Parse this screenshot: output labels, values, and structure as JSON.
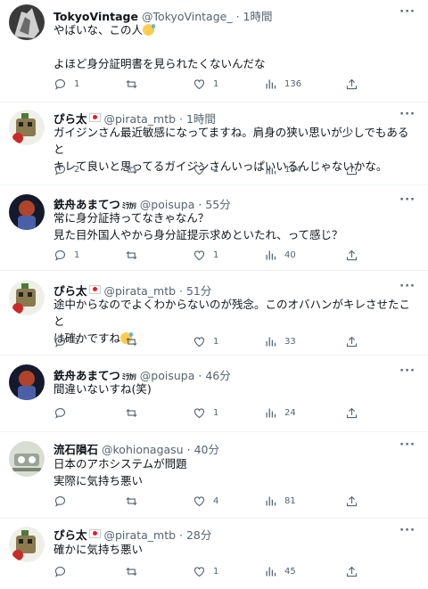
{
  "tweets": [
    {
      "name": "TokyoVintage",
      "handle": "@TokyoVintage_",
      "time": "1時間",
      "lines": [
        "やばいな、この人",
        "",
        "よほど身分証明書を見られたくないんだな"
      ],
      "emoji_after_line_1": "grinning-sweat",
      "replies": "1",
      "retweets": "",
      "likes": "1",
      "views": "136",
      "avatar": "tokyovintage-avatar"
    },
    {
      "name": "ぴら太",
      "handle": "@pirata_mtb",
      "time": "1時間",
      "lines": [
        "ガイジンさん最近敏感になってますね。肩身の狭い思いが少しでもあると",
        "キレて良いと思ってるガイジンさんいっぱいいるんじゃないかな。"
      ],
      "replies": "2",
      "retweets": "",
      "likes": "1",
      "views": "134",
      "avatar": "pirata-avatar"
    },
    {
      "name": "鉄舟あまてつ",
      "badge": "ﾐﾗｶﾘ",
      "handle": "@poisupa",
      "time": "55分",
      "lines": [
        "常に身分証持ってなきゃなん？",
        "見た目外国人やから身分証提示求めといたれ、って感じ？"
      ],
      "replies": "1",
      "retweets": "",
      "likes": "1",
      "views": "40",
      "avatar": "poisupa-avatar"
    },
    {
      "name": "ぴら太",
      "handle": "@pirata_mtb",
      "time": "51分",
      "lines": [
        "途中からなのでよくわからないのが残念。このオバハンがキレさせたこと",
        "は確かですね"
      ],
      "replies": "1",
      "retweets": "",
      "likes": "1",
      "views": "33",
      "avatar": "pirata-avatar"
    },
    {
      "name": "鉄舟あまてつ",
      "badge": "ﾐﾗｶﾘ",
      "handle": "@poisupa",
      "time": "46分",
      "lines": [
        "間違いないすね(笑)"
      ],
      "replies": "",
      "retweets": "",
      "likes": "1",
      "views": "24",
      "avatar": "poisupa-avatar"
    },
    {
      "name": "流石隕石",
      "handle": "@kohionagasu",
      "time": "40分",
      "lines": [
        "日本のアホシステムが問題",
        "実際に気持ち悪い"
      ],
      "replies": "",
      "retweets": "",
      "likes": "4",
      "views": "81",
      "avatar": "kohionagasu-avatar"
    },
    {
      "name": "ぴら太",
      "handle": "@pirata_mtb",
      "time": "28分",
      "lines": [
        "確かに気持ち悪い"
      ],
      "replies": "",
      "retweets": "",
      "likes": "1",
      "views": "45",
      "avatar": "pirata-avatar"
    }
  ],
  "colors": {
    "text": "#0f1419",
    "muted": "#536471",
    "divider": "#eff3f4",
    "flag_red": "#e0202a"
  },
  "icons": [
    "reply-icon",
    "retweet-icon",
    "like-icon",
    "views-icon",
    "share-icon",
    "more-icon"
  ]
}
